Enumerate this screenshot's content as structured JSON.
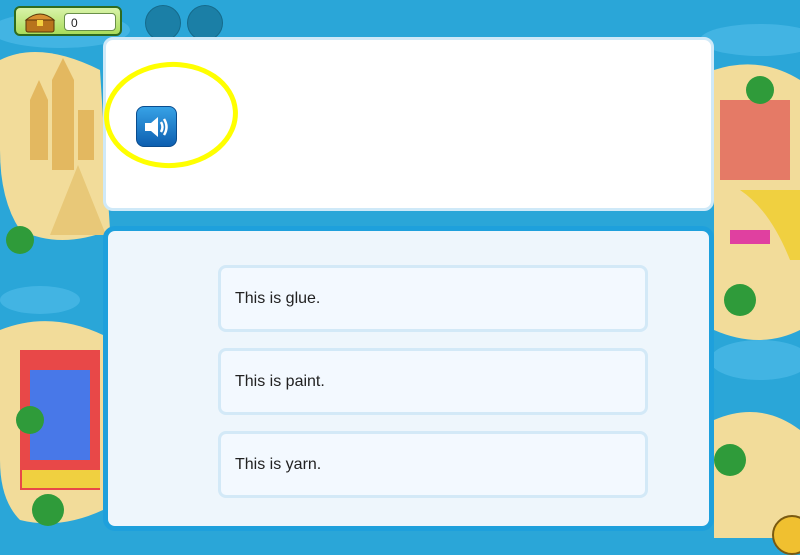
{
  "hud": {
    "coin_count": "0",
    "chest_icon": "treasure-chest-icon"
  },
  "question": {
    "audio_icon": "speaker-icon"
  },
  "answers": {
    "options": [
      {
        "label": "This is glue."
      },
      {
        "label": "This is paint."
      },
      {
        "label": "This is yarn."
      }
    ]
  },
  "colors": {
    "water": "#2aa6d8",
    "sand": "#f2dc9a",
    "panel_border": "#1ea0dc",
    "highlight": "#ffff00"
  }
}
